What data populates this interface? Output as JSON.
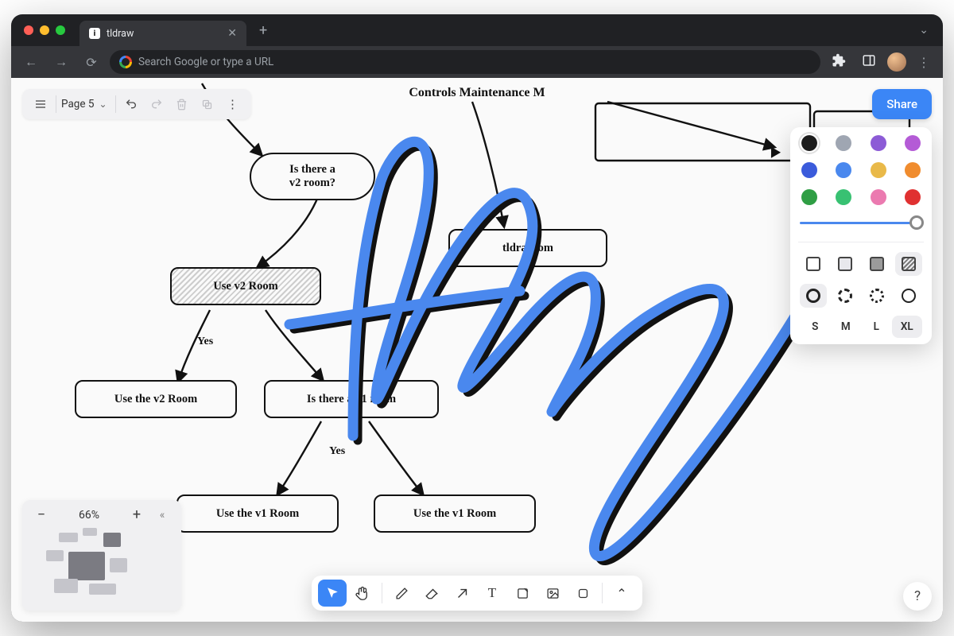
{
  "browser": {
    "tab_title": "tldraw",
    "omnibox_placeholder": "Search Google or type a URL"
  },
  "toolbar": {
    "page_label": "Page 5"
  },
  "share_label": "Share",
  "canvas": {
    "heading": "Controls Maintenance M",
    "nodes": {
      "is_v2_room": "Is there a\nv2 room?",
      "use_v2_room_box": "Use v2 Room",
      "use_the_v2_room": "Use the v2 Room",
      "is_v1_room": "Is there a v1 room",
      "use_the_v1_room_a": "Use the v1 Room",
      "use_the_v1_room_b": "Use the v1 Room",
      "tldraw_com": "tldraw     om"
    },
    "edge_labels": {
      "yes_1": "Yes",
      "yes_2": "Yes"
    }
  },
  "style_panel": {
    "colors": [
      {
        "hex": "#1d1d1d",
        "selected": true
      },
      {
        "hex": "#9fa6b2"
      },
      {
        "hex": "#8c5bd6"
      },
      {
        "hex": "#b45bd6"
      },
      {
        "hex": "#3b5bdb"
      },
      {
        "hex": "#4a88ee"
      },
      {
        "hex": "#e9b949"
      },
      {
        "hex": "#f08c2e"
      },
      {
        "hex": "#2f9e44"
      },
      {
        "hex": "#38c172"
      },
      {
        "hex": "#eb7ab0"
      },
      {
        "hex": "#e03131"
      }
    ],
    "fills": [
      "none",
      "semi",
      "solid",
      "pattern"
    ],
    "fill_selected": 3,
    "dashes": [
      "draw",
      "dashed",
      "dotted",
      "solid"
    ],
    "dash_selected": 0,
    "sizes": [
      "S",
      "M",
      "L",
      "XL"
    ],
    "size_selected": 3
  },
  "zoom": {
    "level": "66%"
  },
  "help_label": "?",
  "tools": [
    "select",
    "hand",
    "draw",
    "eraser",
    "arrow",
    "text",
    "note",
    "image",
    "shape",
    "more"
  ]
}
